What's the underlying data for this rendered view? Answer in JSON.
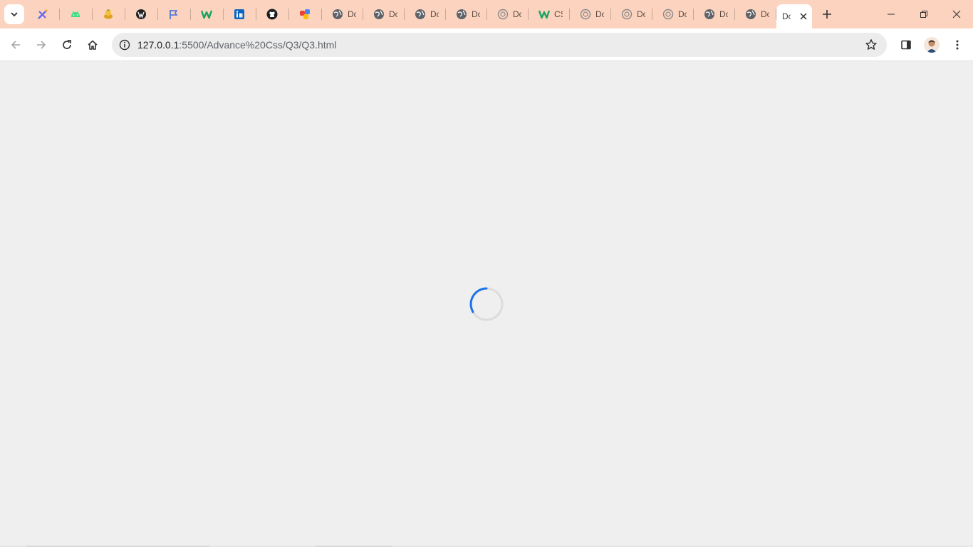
{
  "browser": {
    "tabs": [
      {
        "title": "",
        "icon": "pen-app-icon",
        "color": "#4a6cf7"
      },
      {
        "title": "",
        "icon": "android-icon",
        "color": "#3ddc84"
      },
      {
        "title": "",
        "icon": "coins-icon",
        "color": "#e0a020"
      },
      {
        "title": "",
        "icon": "wordpress-icon",
        "color": "#222222"
      },
      {
        "title": "",
        "icon": "flag-icon",
        "color": "#3b6fd8"
      },
      {
        "title": "",
        "icon": "w-brand-icon",
        "color": "#1aa260"
      },
      {
        "title": "",
        "icon": "linkedin-icon",
        "color": "#0a66c2"
      },
      {
        "title": "",
        "icon": "github-icon",
        "color": "#1b1f23"
      },
      {
        "title": "",
        "icon": "colorful-app-icon",
        "color": "#e94235"
      },
      {
        "title": "Do",
        "icon": "globe-icon",
        "color": "#5f6368"
      },
      {
        "title": "Do",
        "icon": "globe-icon",
        "color": "#5f6368"
      },
      {
        "title": "Do",
        "icon": "globe-icon",
        "color": "#5f6368"
      },
      {
        "title": "Do",
        "icon": "globe-icon",
        "color": "#5f6368"
      },
      {
        "title": "Do",
        "icon": "globe-outline-icon",
        "color": "#8a8a8a"
      },
      {
        "title": "CS",
        "icon": "w-brand-icon",
        "color": "#1aa260"
      },
      {
        "title": "Do",
        "icon": "globe-outline-icon",
        "color": "#8a8a8a"
      },
      {
        "title": "Do",
        "icon": "globe-outline-icon",
        "color": "#8a8a8a"
      },
      {
        "title": "Do",
        "icon": "globe-outline-icon",
        "color": "#8a8a8a"
      },
      {
        "title": "Do",
        "icon": "globe-icon",
        "color": "#5f6368"
      },
      {
        "title": "Do",
        "icon": "globe-icon",
        "color": "#5f6368"
      }
    ],
    "active_tab": {
      "title": "Do"
    },
    "address": {
      "host": "127.0.0.1",
      "path": ":5500/Advance%20Css/Q3/Q3.html"
    },
    "colors": {
      "tabstrip": "#fbd3bf",
      "spinner": "#1a73e8",
      "page": "#efefef"
    }
  },
  "page": {
    "state": "loading"
  }
}
